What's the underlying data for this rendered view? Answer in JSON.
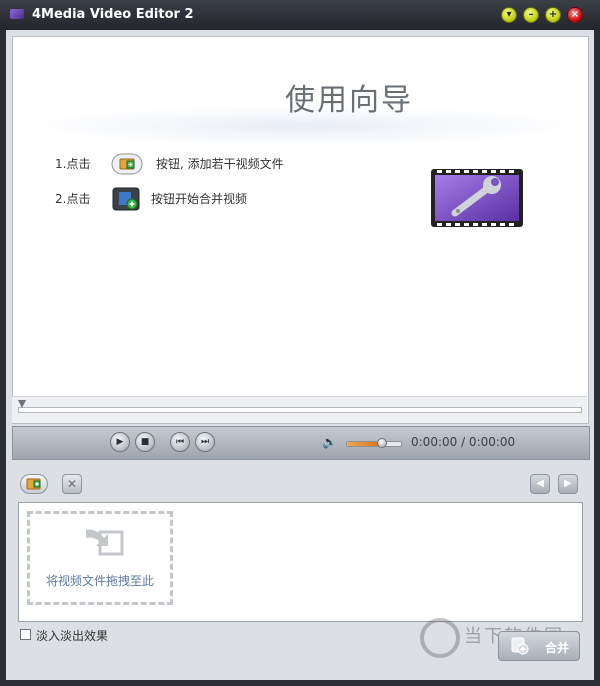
{
  "window": {
    "title": "4Media Video Editor 2"
  },
  "wizard": {
    "title": "使用向导",
    "step1_num": "1.点击",
    "step1_text": "按钮, 添加若干视频文件",
    "step2_num": "2.点击",
    "step2_text": "按钮开始合并视频"
  },
  "player": {
    "time": "0:00:00 / 0:00:00",
    "volume_level": 0.65
  },
  "filelist": {
    "drop_text": "将视频文件拖拽至此"
  },
  "options": {
    "fade_label": "淡入淡出效果",
    "fade_checked": false
  },
  "merge": {
    "label": "合并"
  },
  "watermark": {
    "text": "当下软件园"
  },
  "colors": {
    "accent": "#d4701b",
    "title_bar": "#2b2e33",
    "panel": "#dcdfe3"
  },
  "icons": [
    "app-icon",
    "help-icon",
    "minimize-icon",
    "maximize-icon",
    "close-icon",
    "add-file-icon",
    "merge-icon",
    "film-wrench-icon",
    "play-icon",
    "stop-icon",
    "prev-icon",
    "next-icon",
    "volume-icon",
    "delete-icon",
    "nav-left-icon",
    "nav-right-icon",
    "drop-arrow-icon"
  ]
}
